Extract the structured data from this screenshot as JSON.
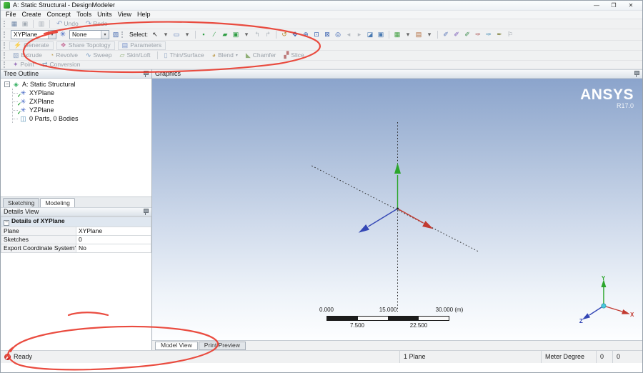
{
  "colors": {
    "axis-x": "#c23a30",
    "axis-y": "#2ca62c",
    "axis-z": "#3447b5",
    "triad-center": "#49c8dc",
    "annotation": "#e8392b",
    "brand": "#ffffff",
    "ready-status": "#c01515"
  },
  "window": {
    "title": "A: Static Structural - DesignModeler",
    "controls": {
      "minimize": "—",
      "maximize": "❐",
      "close": "✕"
    }
  },
  "menubar": {
    "items": [
      "File",
      "Create",
      "Concept",
      "Tools",
      "Units",
      "View",
      "Help"
    ]
  },
  "icons": {
    "dropdown_arrow": "▾",
    "expander": "−",
    "check": "✓",
    "plane_glyph": "✳",
    "sketch_glyph": "▨",
    "project": "◈",
    "parts": "◫"
  },
  "toolbars": {
    "standard_icons": [
      {
        "name": "new-session-icon",
        "glyph": "▦",
        "color": "#7289a9"
      },
      {
        "name": "save-project-icon",
        "glyph": "▣",
        "color": "#a3abb4"
      }
    ],
    "print_icons": [
      {
        "name": "print-icon",
        "glyph": "▥",
        "color": "#a3abb4"
      }
    ],
    "undo": {
      "label": "Undo",
      "glyph": "↶"
    },
    "redo": {
      "label": "Redo",
      "glyph": "↷"
    },
    "plane_combo_value": "XYPlane",
    "sketch_combo_value": "None",
    "select_label": "Select:",
    "select_icons": [
      {
        "name": "select-mode-icon",
        "glyph": "↖",
        "color": "#222222"
      },
      {
        "name": "select-mode-arrow-icon",
        "glyph": "▾",
        "color": "#666666"
      },
      {
        "name": "box-select-icon",
        "glyph": "▭",
        "color": "#4a6fb2"
      },
      {
        "name": "box-select-arrow-icon",
        "glyph": "▾",
        "color": "#666666"
      }
    ],
    "filter_icons": [
      {
        "name": "vertex-filter-icon",
        "glyph": "▪",
        "color": "#2f9e44"
      },
      {
        "name": "edge-filter-icon",
        "glyph": "∕",
        "color": "#2f9e44"
      },
      {
        "name": "face-filter-icon",
        "glyph": "▰",
        "color": "#2f9e44"
      },
      {
        "name": "body-filter-icon",
        "glyph": "▣",
        "color": "#2f9e44"
      },
      {
        "name": "extend-selection-icon",
        "glyph": "▾",
        "color": "#666666"
      },
      {
        "name": "previous-selection-icon",
        "glyph": "↰",
        "color": "#b3b9c0"
      },
      {
        "name": "next-selection-icon",
        "glyph": "↱",
        "color": "#b3b9c0"
      }
    ],
    "view_icons": [
      {
        "name": "rotate-icon",
        "glyph": "↺",
        "color": "#b9872f"
      },
      {
        "name": "pan-icon",
        "glyph": "✥",
        "color": "#3a62b0"
      },
      {
        "name": "zoom-icon",
        "glyph": "⊕",
        "color": "#3a62b0"
      },
      {
        "name": "box-zoom-icon",
        "glyph": "⊡",
        "color": "#3a62b0"
      },
      {
        "name": "zoom-fit-icon",
        "glyph": "⊠",
        "color": "#3a62b0"
      },
      {
        "name": "magnifier-window-icon",
        "glyph": "◎",
        "color": "#3a62b0"
      },
      {
        "name": "previous-view-icon",
        "glyph": "◂",
        "color": "#b3b9c0"
      },
      {
        "name": "next-view-icon",
        "glyph": "▸",
        "color": "#b3b9c0"
      },
      {
        "name": "isometric-view-icon",
        "glyph": "◪",
        "color": "#4a7ab2"
      },
      {
        "name": "look-at-face-icon",
        "glyph": "▣",
        "color": "#4a7ab2"
      }
    ],
    "display_icons": [
      {
        "name": "display-style-icon",
        "glyph": "▦",
        "color": "#3f9e3f"
      },
      {
        "name": "display-style-arrow-icon",
        "glyph": "▾",
        "color": "#666666"
      },
      {
        "name": "edge-coloring-icon",
        "glyph": "▤",
        "color": "#b06a3a"
      },
      {
        "name": "edge-coloring-arrow-icon",
        "glyph": "▾",
        "color": "#666666"
      }
    ],
    "annotation_icons": [
      {
        "name": "edge-direction-icon",
        "glyph": "✐",
        "color": "#5a76b8"
      },
      {
        "name": "display-vertices-icon",
        "glyph": "✐",
        "color": "#7a5ab8"
      },
      {
        "name": "display-edges-icon",
        "glyph": "✐",
        "color": "#3f8e4f"
      },
      {
        "name": "cross-section-alignments-icon",
        "glyph": "✑",
        "color": "#b05a5a"
      },
      {
        "name": "ruler-toggle-icon",
        "glyph": "✑",
        "color": "#4a90b8"
      },
      {
        "name": "triad-toggle-icon",
        "glyph": "✒",
        "color": "#8a8a4a"
      },
      {
        "name": "flag-icon",
        "glyph": "⚐",
        "color": "#8a929a"
      }
    ],
    "generate_buttons": [
      {
        "name": "generate-button",
        "label": "Generate",
        "glyph": "⚡",
        "icon_color": "#c8a23a",
        "disabled": true
      },
      {
        "name": "share-topology-button",
        "label": "Share Topology",
        "glyph": "❖",
        "icon_color": "#c05a8a",
        "disabled": true
      },
      {
        "name": "parameters-button",
        "label": "Parameters",
        "glyph": "▤",
        "icon_color": "#5a7ac0",
        "disabled": true
      }
    ],
    "modeling_buttons_a": [
      {
        "name": "extrude-button",
        "label": "Extrude",
        "glyph": "▧",
        "icon_color": "#7a93b8",
        "disabled": true
      },
      {
        "name": "revolve-button",
        "label": "Revolve",
        "glyph": "◔",
        "icon_color": "#b8933a",
        "disabled": true
      },
      {
        "name": "sweep-button",
        "label": "Sweep",
        "glyph": "∿",
        "icon_color": "#4a7ab0",
        "disabled": true
      },
      {
        "name": "skin-loft-button",
        "label": "Skin/Loft",
        "glyph": "▱",
        "icon_color": "#7aa05a",
        "disabled": true
      }
    ],
    "modeling_buttons_b": [
      {
        "name": "thin-surface-button",
        "label": "Thin/Surface",
        "glyph": "▯",
        "icon_color": "#7a93b8",
        "disabled": true
      },
      {
        "name": "blend-button",
        "label": "Blend",
        "glyph": "◕",
        "icon_color": "#b8933a",
        "dropdown": "▾",
        "disabled": true
      },
      {
        "name": "chamfer-button",
        "label": "Chamfer",
        "glyph": "◣",
        "icon_color": "#7aa05a",
        "disabled": true
      },
      {
        "name": "slice-button",
        "label": "Slice",
        "glyph": "▞",
        "icon_color": "#b05a5a",
        "disabled": true
      }
    ],
    "concept_buttons": [
      {
        "name": "point-button",
        "label": "Point",
        "glyph": "✦",
        "icon_color": "#8a5ab0",
        "disabled": true
      },
      {
        "name": "conversion-button",
        "label": "Conversion",
        "glyph": "⇄",
        "icon_color": "#5a8ab0",
        "disabled": true
      }
    ]
  },
  "tree": {
    "header": "Tree Outline",
    "root_label": "A: Static Structural",
    "planes": [
      "XYPlane",
      "ZXPlane",
      "YZPlane"
    ],
    "parts_label": "0 Parts, 0 Bodies",
    "tabs": [
      "Sketching",
      "Modeling"
    ]
  },
  "details": {
    "header": "Details View",
    "group_header": "Details of XYPlane",
    "rows": [
      {
        "label": "Plane",
        "value": "XYPlane"
      },
      {
        "label": "Sketches",
        "value": "0"
      },
      {
        "label": "Export Coordinate System?",
        "value": "No"
      }
    ]
  },
  "graphics": {
    "header": "Graphics",
    "brand": "ANSYS",
    "brand_version": "R17.0",
    "axis_labels": {
      "x": "X",
      "y": "Y",
      "z": "Z"
    },
    "ruler": {
      "top_labels": [
        "0.000",
        "15.000",
        "30.000 (m)"
      ],
      "bottom_labels": [
        "7.500",
        "22.500"
      ]
    },
    "tabs": [
      "Model View",
      "Print Preview"
    ]
  },
  "statusbar": {
    "status": "Ready",
    "selection": "1 Plane",
    "units": "Meter Degree",
    "counter1": "0",
    "counter2": "0"
  }
}
